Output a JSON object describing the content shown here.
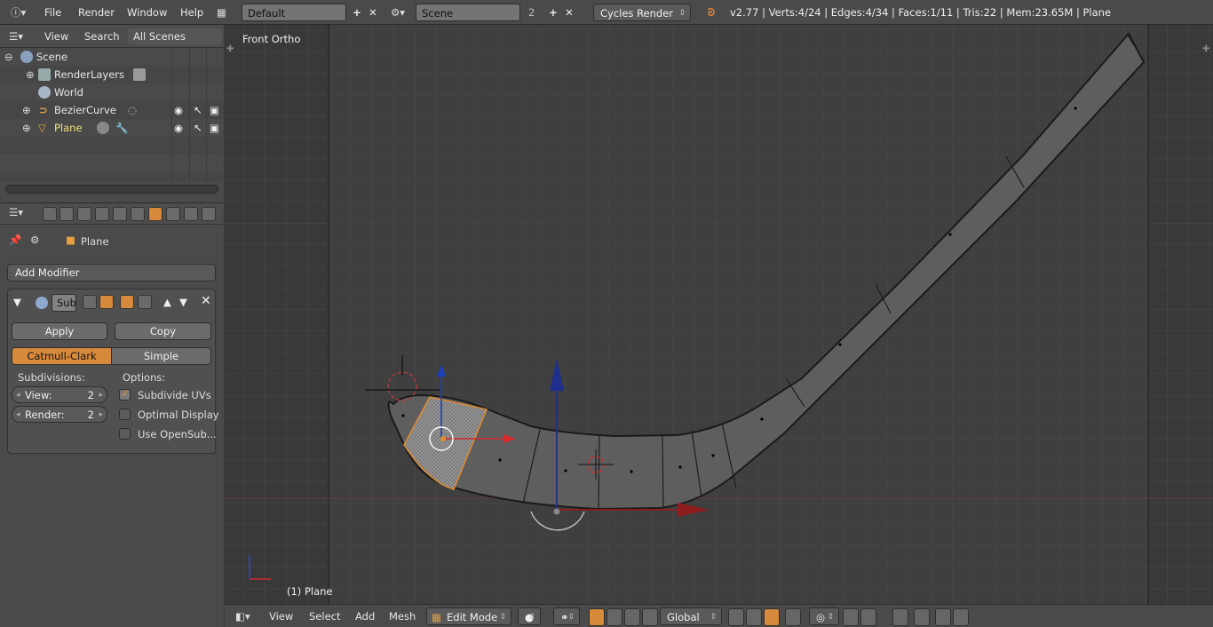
{
  "topbar": {
    "menus": [
      "File",
      "Render",
      "Window",
      "Help"
    ],
    "layout": "Default",
    "scene": "Scene",
    "scene_users": "2",
    "engine": "Cycles Render",
    "stats": "v2.77 | Verts:4/24 | Edges:4/34 | Faces:1/11 | Tris:22 | Mem:23.65M | Plane"
  },
  "outliner": {
    "view": "View",
    "search": "Search",
    "filter": "All Scenes",
    "items": [
      {
        "label": "Scene",
        "icon": "scene-icon"
      },
      {
        "label": "RenderLayers",
        "icon": "renderlayers-icon"
      },
      {
        "label": "World",
        "icon": "world-icon"
      },
      {
        "label": "BezierCurve",
        "icon": "curve-icon"
      },
      {
        "label": "Plane",
        "icon": "mesh-icon"
      }
    ]
  },
  "properties": {
    "object_name": "Plane",
    "add_modifier": "Add Modifier",
    "modifier_name": "Sub",
    "apply": "Apply",
    "copy": "Copy",
    "catmull": "Catmull-Clark",
    "simple": "Simple",
    "subdivisions_label": "Subdivisions:",
    "options_label": "Options:",
    "view_label": "View:",
    "view_value": "2",
    "render_label": "Render:",
    "render_value": "2",
    "opt_uvs": "Subdivide UVs",
    "opt_optimal": "Optimal Display",
    "opt_opensub": "Use OpenSub..."
  },
  "viewport": {
    "view_name": "Front Ortho",
    "object_label": "(1) Plane"
  },
  "bottombar": {
    "menus": [
      "View",
      "Select",
      "Add",
      "Mesh"
    ],
    "mode": "Edit Mode",
    "orientation": "Global"
  },
  "colors": {
    "accent": "#d88a3c",
    "selected_text": "#f2e07a",
    "axis_x": "#d42a2a",
    "axis_z": "#1e3fb8"
  }
}
